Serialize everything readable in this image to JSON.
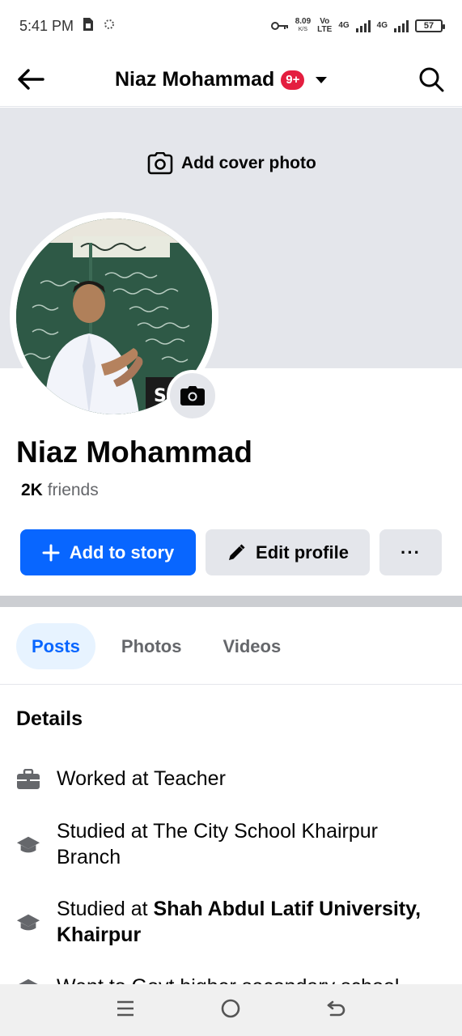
{
  "status_bar": {
    "time": "5:41 PM",
    "net_speed_value": "8.09",
    "net_speed_unit": "K/S",
    "volte_top": "Vo",
    "volte_bottom": "LTE",
    "net1": "4G",
    "net2": "4G",
    "battery": "57"
  },
  "nav": {
    "title": "Niaz Mohammad",
    "badge": "9+"
  },
  "cover": {
    "add_cover_label": "Add cover photo"
  },
  "profile": {
    "name": "Niaz Mohammad",
    "friends_count": "2K",
    "friends_label": "friends"
  },
  "actions": {
    "add_story_label": "Add to story",
    "edit_profile_label": "Edit profile",
    "more_label": "···"
  },
  "tabs": [
    {
      "label": "Posts",
      "active": true
    },
    {
      "label": "Photos",
      "active": false
    },
    {
      "label": "Videos",
      "active": false
    }
  ],
  "details": {
    "title": "Details",
    "items": [
      {
        "icon": "briefcase-icon",
        "prefix": "Worked at Teacher",
        "bold": ""
      },
      {
        "icon": "graduation-cap-icon",
        "prefix": "Studied at The City School Khairpur Branch",
        "bold": ""
      },
      {
        "icon": "graduation-cap-icon",
        "prefix": "Studied at ",
        "bold": "Shah Abdul Latif University, Khairpur"
      },
      {
        "icon": "graduation-cap-icon",
        "prefix": "Went to Govt higher secondary school",
        "bold": ""
      }
    ]
  },
  "colors": {
    "accent": "#0866ff",
    "badge": "#e41e3f",
    "tab_active_bg": "#e7f3ff"
  }
}
